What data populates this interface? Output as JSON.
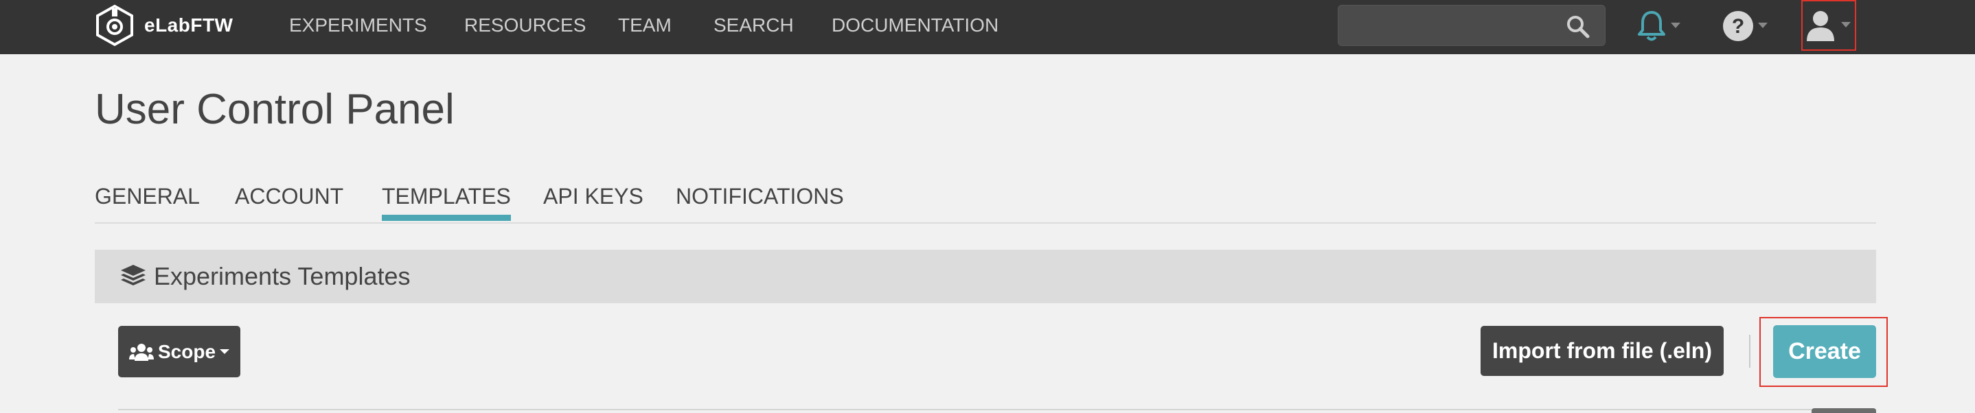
{
  "navbar": {
    "brand": "eLabFTW",
    "links": [
      "EXPERIMENTS",
      "RESOURCES",
      "TEAM",
      "SEARCH",
      "DOCUMENTATION"
    ],
    "search_placeholder": "",
    "icons": [
      "bell-icon",
      "help-icon",
      "user-icon"
    ]
  },
  "page": {
    "title": "User Control Panel"
  },
  "tabs": [
    "GENERAL",
    "ACCOUNT",
    "TEMPLATES",
    "API KEYS",
    "NOTIFICATIONS"
  ],
  "active_tab": "TEMPLATES",
  "section": {
    "title": "Experiments Templates"
  },
  "toolbar": {
    "scope_label": "Scope",
    "import_label": "Import from file (.eln)",
    "create_label": "Create"
  },
  "colors": {
    "navbar": "#343434",
    "accent": "#4ba7b3",
    "create_button": "#56afbb",
    "highlight_border": "#e0332a"
  }
}
